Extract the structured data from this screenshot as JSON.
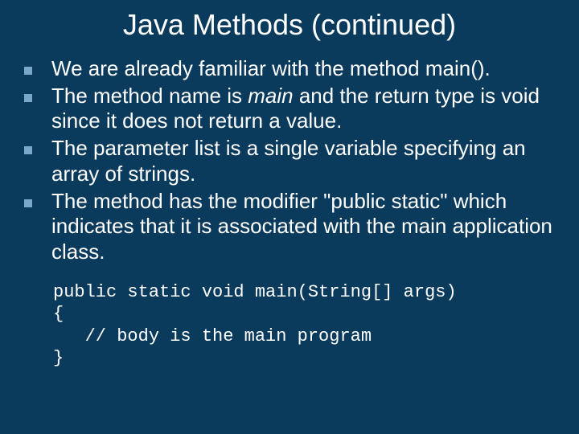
{
  "title": "Java Methods (continued)",
  "bullets": [
    {
      "pre": "We are already familiar with the method main().",
      "italic": "",
      "post": ""
    },
    {
      "pre": "The method name is ",
      "italic": "main",
      "post": " and the return type is void since it does not return a value."
    },
    {
      "pre": "The parameter list is a single variable specifying an array of strings.",
      "italic": "",
      "post": ""
    },
    {
      "pre": "The method has the modifier \"public static\" which indicates that it is associated with the main application class.",
      "italic": "",
      "post": ""
    }
  ],
  "code": "public static void main(String[] args)\n{\n   // body is the main program\n}"
}
